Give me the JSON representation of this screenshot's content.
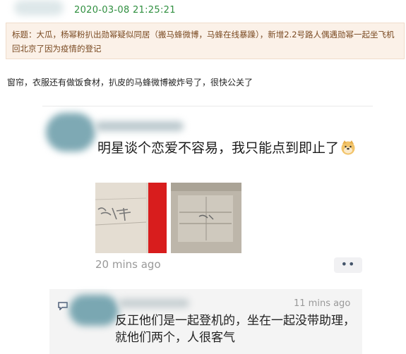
{
  "timestamp": "2020-03-08 21:25:21",
  "title": "标题：大瓜，杨幂粉扒出勋幂疑似同居（搬马蜂微博，马蜂在线暴躁），新增2.2号路人偶遇勋幂一起坐飞机回北京了因为疫情的登记",
  "body_text": "窗帘，衣服还有做饭食材，扒皮的马蜂微博被炸号了，很快公关了",
  "post": {
    "text": "明星谈个恋爱不容易，我只能点到即止了",
    "emoji": "doge-emoji",
    "photo_count": 2,
    "time_ago": "20 mins ago",
    "more_glyph": "••"
  },
  "comment": {
    "time_ago": "11 mins ago",
    "text": "反正他们是一起登机的，坐在一起没带助理，就他们两个，人很客气"
  },
  "colors": {
    "timestamp": "#2f8f3f",
    "title_bg": "#fbf1e8",
    "title_text": "#7a4a22",
    "comment_bg": "#f4f4f4"
  }
}
